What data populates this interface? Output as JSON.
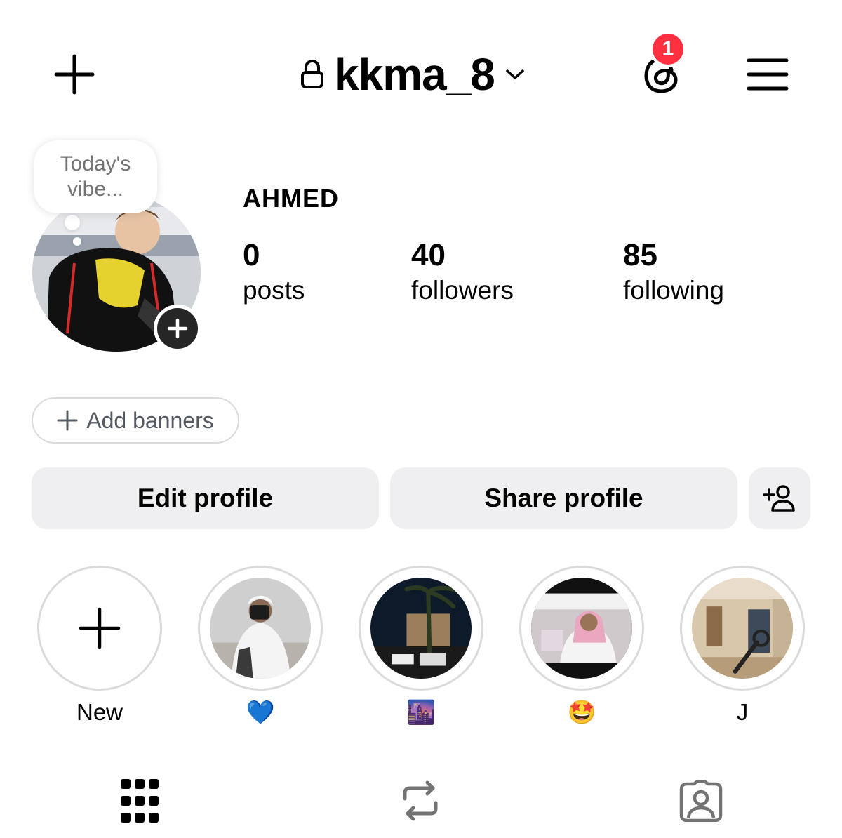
{
  "header": {
    "new_icon": "plus-icon",
    "lock_icon": "lock-icon",
    "username": "kkma_8",
    "switch_icon": "chevron-down-icon",
    "threads_icon": "threads-icon",
    "notification_count": "1",
    "menu_icon": "hamburger-menu-icon"
  },
  "profile": {
    "note_text": "Today's vibe...",
    "display_name": "AHMED",
    "stats": [
      {
        "value": "0",
        "label": "posts"
      },
      {
        "value": "40",
        "label": "followers"
      },
      {
        "value": "85",
        "label": "following"
      }
    ],
    "add_story_icon": "plus-icon"
  },
  "banners": {
    "label": "Add banners",
    "icon": "plus-icon"
  },
  "actions": {
    "edit_label": "Edit profile",
    "share_label": "Share profile",
    "discover_icon": "add-person-icon"
  },
  "highlights": [
    {
      "label": "New"
    },
    {
      "label": "💙"
    },
    {
      "label": "🌆"
    },
    {
      "label": "🤩"
    },
    {
      "label": "J"
    }
  ],
  "tabs": [
    {
      "icon": "grid-icon"
    },
    {
      "icon": "reposts-icon"
    },
    {
      "icon": "tagged-icon"
    }
  ],
  "colors": {
    "badge": "#ff3040",
    "button_bg": "#efeff1",
    "ring": "#dbdbdb"
  }
}
